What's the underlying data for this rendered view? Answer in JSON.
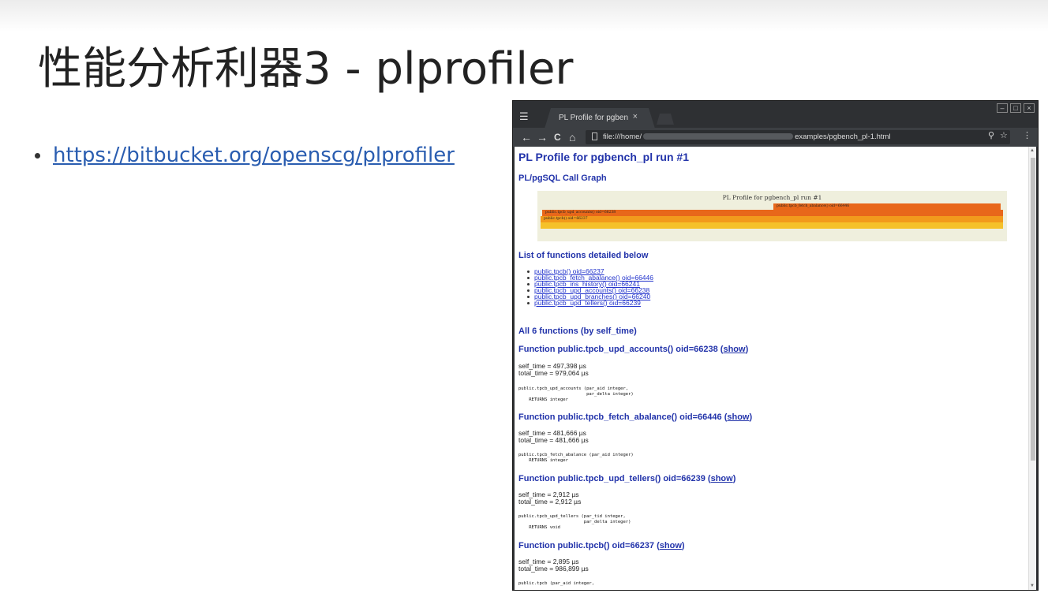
{
  "slide": {
    "title": "性能分析利器3 - plprofiler",
    "bullet_link": "https://bitbucket.org/openscg/plprofiler"
  },
  "browser": {
    "tab_title": "PL Profile for pgben",
    "tab_close": "×",
    "url_prefix": "file:///home/",
    "url_suffix": "examples/pgbench_pl-1.html",
    "nav_back": "←",
    "nav_forward": "→",
    "nav_reload": "C",
    "nav_home": "⌂",
    "zoom_icon": "⚲",
    "star_icon": "☆",
    "menu_icon": "⋮",
    "win_min": "–",
    "win_max": "□",
    "win_close": "×"
  },
  "page": {
    "heading": "PL Profile for pgbench_pl run #1",
    "call_graph_heading": "PL/pgSQL Call Graph",
    "graph": {
      "title": "PL Profile for pgbench_pl run #1",
      "bars": [
        {
          "label": "public.tpcb_fetch_abalance() oid=66446",
          "color": "#e8671a"
        },
        {
          "label": "public.tpcb_upd_accounts() oid=66238",
          "color": "#e8671a"
        },
        {
          "label": "public.tpcb() oid=66237",
          "color": "#f29a1c"
        },
        {
          "label": "",
          "color": "#f5c12a"
        }
      ]
    },
    "list_heading": "List of functions detailed below",
    "functions_list": [
      "public.tpcb() oid=66237",
      "public.tpcb_fetch_abalance() oid=66446",
      "public.tpcb_ins_history() oid=66241",
      "public.tpcb_upd_accounts() oid=66238",
      "public.tpcb_upd_branches() oid=66240",
      "public.tpcb_upd_tellers() oid=66239"
    ],
    "all_heading": "All 6 functions (by self_time)",
    "show_label": "show",
    "functions": [
      {
        "title": "Function public.tpcb_upd_accounts() oid=66238",
        "stats": "self_time = 497,398 µs\ntotal_time = 979,064 µs",
        "signature": "public.tpcb_upd_accounts (par_aid integer,\n                          par_delta integer)\n    RETURNS integer"
      },
      {
        "title": "Function public.tpcb_fetch_abalance() oid=66446",
        "stats": "self_time = 481,666 µs\ntotal_time = 481,666 µs",
        "signature": "public.tpcb_fetch_abalance (par_aid integer)\n    RETURNS integer"
      },
      {
        "title": "Function public.tpcb_upd_tellers() oid=66239",
        "stats": "self_time = 2,912 µs\ntotal_time = 2,912 µs",
        "signature": "public.tpcb_upd_tellers (par_tid integer,\n                         par_delta integer)\n    RETURNS void"
      },
      {
        "title": "Function public.tpcb() oid=66237",
        "stats": "self_time = 2,895 µs\ntotal_time = 986,899 µs",
        "signature": "public.tpcb (par_aid integer,"
      }
    ]
  }
}
